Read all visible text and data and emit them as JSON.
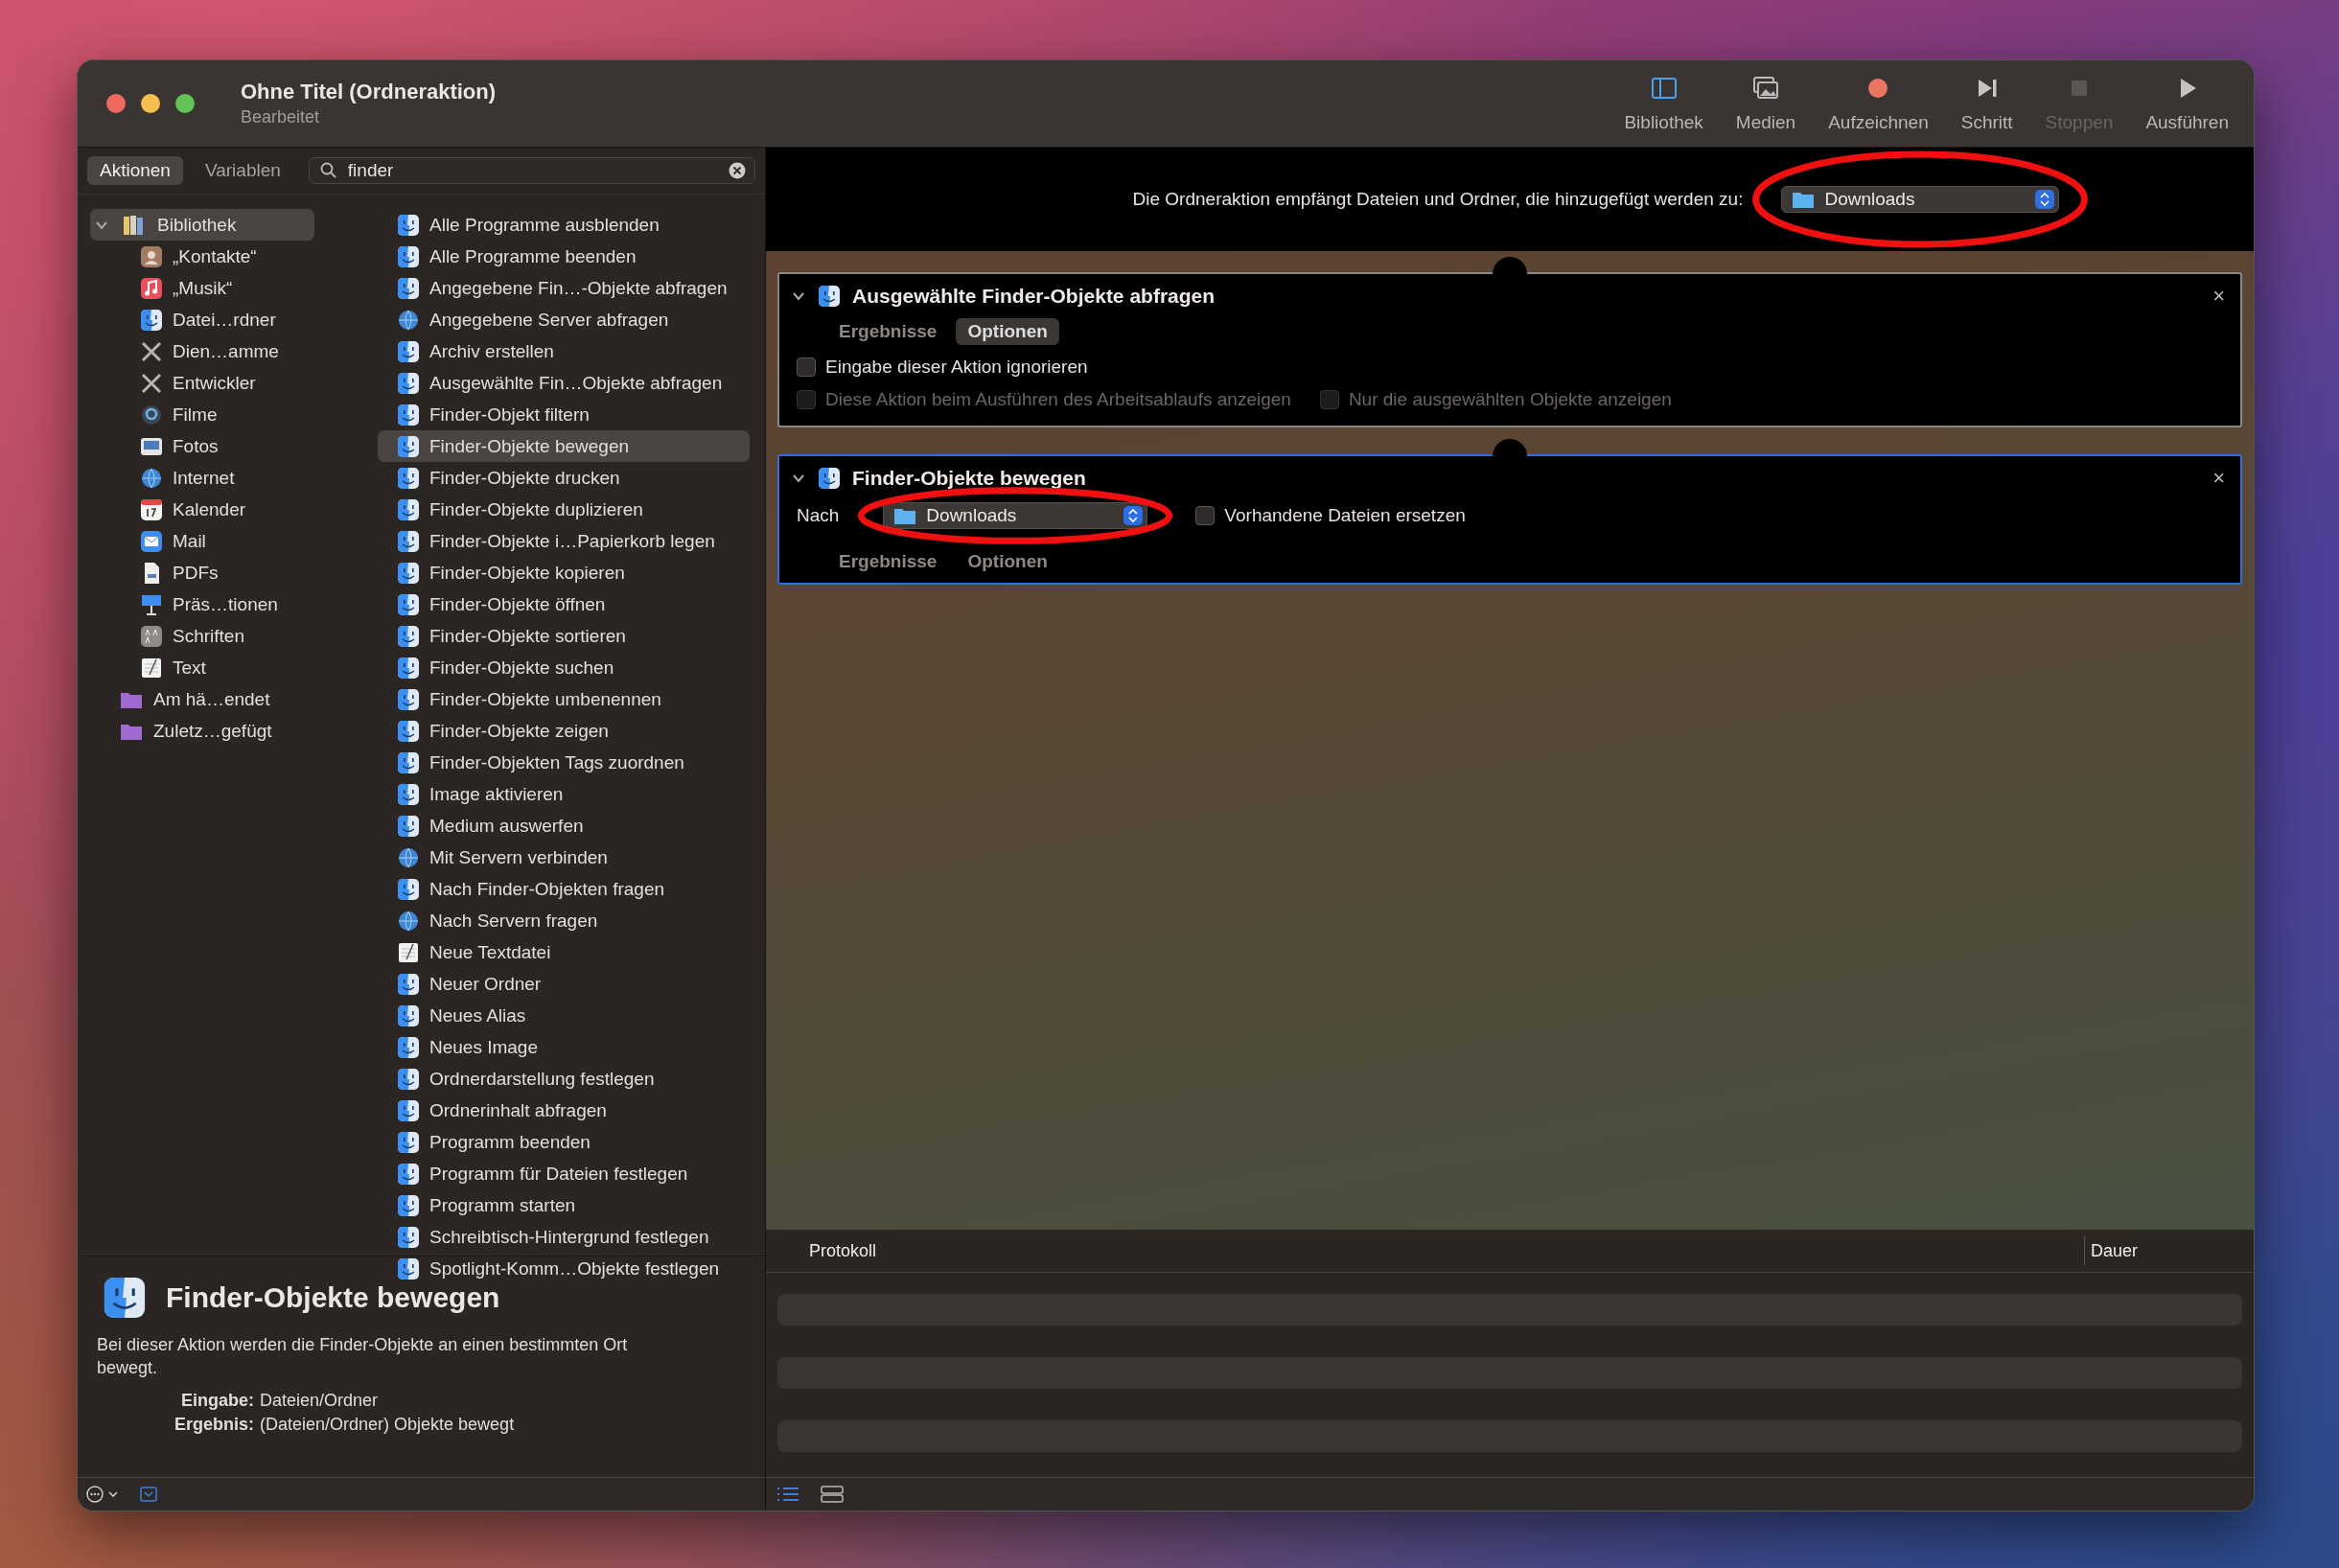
{
  "window": {
    "title": "Ohne Titel (Ordneraktion)",
    "subtitle": "Bearbeitet"
  },
  "toolbar": [
    {
      "kind": "library",
      "label": "Bibliothek",
      "disabled": false
    },
    {
      "kind": "media",
      "label": "Medien",
      "disabled": false
    },
    {
      "kind": "record",
      "label": "Aufzeichnen",
      "disabled": false
    },
    {
      "kind": "step",
      "label": "Schritt",
      "disabled": false
    },
    {
      "kind": "stop",
      "label": "Stoppen",
      "disabled": true
    },
    {
      "kind": "run",
      "label": "Ausführen",
      "disabled": false
    }
  ],
  "library_tabs": [
    {
      "label": "Aktionen",
      "selected": true
    },
    {
      "label": "Variablen",
      "selected": false
    }
  ],
  "search": {
    "value": "finder"
  },
  "categories": [
    {
      "label": "Bibliothek",
      "kind": "library",
      "expanded": true,
      "selected": true,
      "children": [
        {
          "label": "„Kontakte“",
          "kind": "contacts",
          "selected": false
        },
        {
          "label": "„Musik“",
          "kind": "music",
          "selected": false
        },
        {
          "label": "Datei…rdner",
          "kind": "finder",
          "selected": false
        },
        {
          "label": "Dien…amme",
          "kind": "tools",
          "selected": false
        },
        {
          "label": "Entwickler",
          "kind": "tools",
          "selected": false
        },
        {
          "label": "Filme",
          "kind": "movies",
          "selected": false
        },
        {
          "label": "Fotos",
          "kind": "photos",
          "selected": false
        },
        {
          "label": "Internet",
          "kind": "globe",
          "selected": false
        },
        {
          "label": "Kalender",
          "kind": "calendar",
          "selected": false
        },
        {
          "label": "Mail",
          "kind": "mail",
          "selected": false
        },
        {
          "label": "PDFs",
          "kind": "document",
          "selected": false
        },
        {
          "label": "Präs…tionen",
          "kind": "presentation",
          "selected": false
        },
        {
          "label": "Schriften",
          "kind": "fonts",
          "selected": false
        },
        {
          "label": "Text",
          "kind": "text",
          "selected": false
        }
      ]
    },
    {
      "label": "Am hä…endet",
      "kind": "folder",
      "selected": false
    },
    {
      "label": "Zuletz…gefügt",
      "kind": "folder",
      "selected": false
    }
  ],
  "actions": [
    {
      "label": "Alle Programme ausblenden",
      "kind": "finder",
      "selected": false
    },
    {
      "label": "Alle Programme beenden",
      "kind": "finder",
      "selected": false
    },
    {
      "label": "Angegebene Fin…-Objekte abfragen",
      "kind": "finder",
      "selected": false
    },
    {
      "label": "Angegebene Server abfragen",
      "kind": "globe",
      "selected": false
    },
    {
      "label": "Archiv erstellen",
      "kind": "finder",
      "selected": false
    },
    {
      "label": "Ausgewählte Fin…Objekte abfragen",
      "kind": "finder",
      "selected": false
    },
    {
      "label": "Finder-Objekt filtern",
      "kind": "finder",
      "selected": false
    },
    {
      "label": "Finder-Objekte bewegen",
      "kind": "finder",
      "selected": true
    },
    {
      "label": "Finder-Objekte drucken",
      "kind": "finder",
      "selected": false
    },
    {
      "label": "Finder-Objekte duplizieren",
      "kind": "finder",
      "selected": false
    },
    {
      "label": "Finder-Objekte i…Papierkorb legen",
      "kind": "finder",
      "selected": false
    },
    {
      "label": "Finder-Objekte kopieren",
      "kind": "finder",
      "selected": false
    },
    {
      "label": "Finder-Objekte öffnen",
      "kind": "finder",
      "selected": false
    },
    {
      "label": "Finder-Objekte sortieren",
      "kind": "finder",
      "selected": false
    },
    {
      "label": "Finder-Objekte suchen",
      "kind": "finder",
      "selected": false
    },
    {
      "label": "Finder-Objekte umbenennen",
      "kind": "finder",
      "selected": false
    },
    {
      "label": "Finder-Objekte zeigen",
      "kind": "finder",
      "selected": false
    },
    {
      "label": "Finder-Objekten Tags zuordnen",
      "kind": "finder",
      "selected": false
    },
    {
      "label": "Image aktivieren",
      "kind": "finder",
      "selected": false
    },
    {
      "label": "Medium auswerfen",
      "kind": "finder",
      "selected": false
    },
    {
      "label": "Mit Servern verbinden",
      "kind": "globe",
      "selected": false
    },
    {
      "label": "Nach Finder-Objekten fragen",
      "kind": "finder",
      "selected": false
    },
    {
      "label": "Nach Servern fragen",
      "kind": "globe",
      "selected": false
    },
    {
      "label": "Neue Textdatei",
      "kind": "text",
      "selected": false
    },
    {
      "label": "Neuer Ordner",
      "kind": "finder",
      "selected": false
    },
    {
      "label": "Neues Alias",
      "kind": "finder",
      "selected": false
    },
    {
      "label": "Neues Image",
      "kind": "finder",
      "selected": false
    },
    {
      "label": "Ordnerdarstellung festlegen",
      "kind": "finder",
      "selected": false
    },
    {
      "label": "Ordnerinhalt abfragen",
      "kind": "finder",
      "selected": false
    },
    {
      "label": "Programm beenden",
      "kind": "finder",
      "selected": false
    },
    {
      "label": "Programm für Dateien festlegen",
      "kind": "finder",
      "selected": false
    },
    {
      "label": "Programm starten",
      "kind": "finder",
      "selected": false
    },
    {
      "label": "Schreibtisch-Hintergrund festlegen",
      "kind": "finder",
      "selected": false
    },
    {
      "label": "Spotlight-Komm…Objekte festlegen",
      "kind": "finder",
      "selected": false
    }
  ],
  "description": {
    "title": "Finder-Objekte bewegen",
    "text": "Bei dieser Aktion werden die Finder-Objekte an einen bestimmten Ort bewegt.",
    "fields": [
      {
        "label": "Eingabe:",
        "value": "Dateien/Ordner"
      },
      {
        "label": "Ergebnis:",
        "value": "(Dateien/Ordner) Objekte bewegt"
      }
    ]
  },
  "workflow_header": {
    "text": "Die Ordneraktion empfängt Dateien und Ordner, die hinzugefügt werden zu:",
    "folder": "Downloads",
    "circled": true
  },
  "cards": [
    {
      "kind": "options",
      "title": "Ausgewählte Finder-Objekte abfragen",
      "close": "×",
      "active": false,
      "expanded": true,
      "tabs": [
        {
          "label": "Ergebnisse",
          "selected": false
        },
        {
          "label": "Optionen",
          "selected": true
        }
      ],
      "options": [
        {
          "label": "Eingabe dieser Aktion ignorieren",
          "checked": false,
          "disabled": false
        },
        {
          "label": "Diese Aktion beim Ausführen des Arbeitsablaufs anzeigen",
          "checked": false,
          "disabled": true
        },
        {
          "label": "Nur die ausgewählten Objekte anzeigen",
          "checked": false,
          "disabled": true
        }
      ]
    },
    {
      "kind": "target",
      "title": "Finder-Objekte bewegen",
      "close": "×",
      "active": true,
      "expanded": true,
      "target_label": "Nach",
      "folder": "Downloads",
      "circled": true,
      "tabs": [
        {
          "label": "Ergebnisse",
          "selected": false
        },
        {
          "label": "Optionen",
          "selected": false
        }
      ],
      "options": [
        {
          "label": "Vorhandene Dateien ersetzen",
          "checked": false,
          "disabled": false
        }
      ]
    }
  ],
  "log": {
    "columns": [
      "Protokoll",
      "Dauer"
    ]
  }
}
